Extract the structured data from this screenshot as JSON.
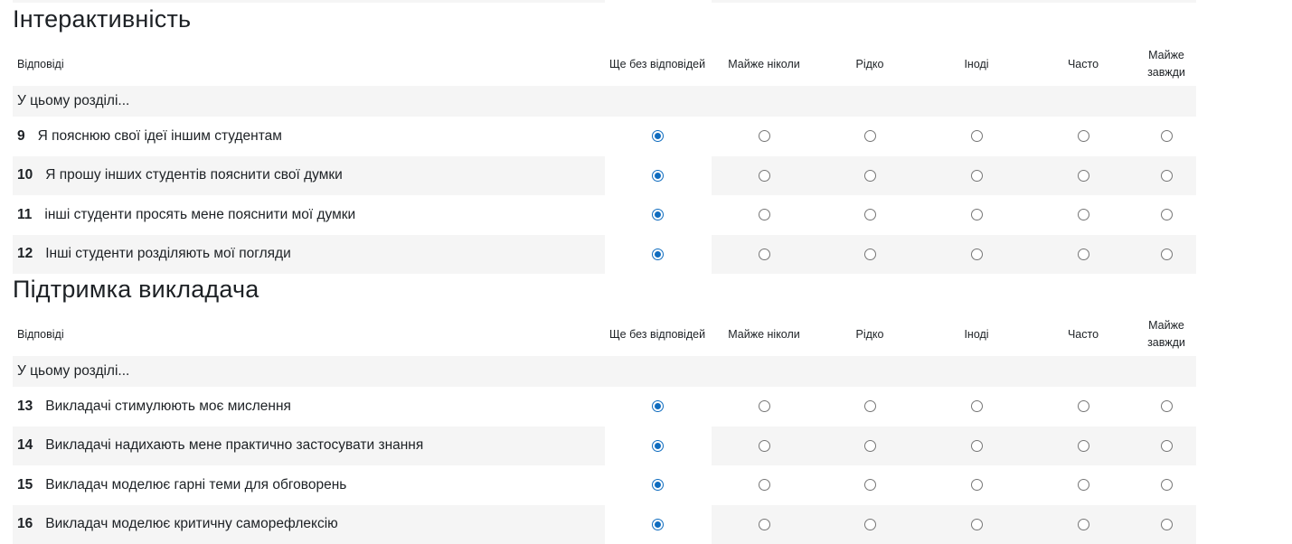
{
  "columns": [
    "Відповіді",
    "Ще без відповідей",
    "Майже ніколи",
    "Рідко",
    "Іноді",
    "Часто",
    "Майже\nзавжди"
  ],
  "colors": {
    "accent": "#0f6cbf",
    "row_shade": "#f5f5f5",
    "text": "#1d2125"
  },
  "sections": [
    {
      "title": "Інтерактивність",
      "intro": "У цьому розділі...",
      "questions": [
        {
          "num": "9",
          "text": "Я пояснюю свої ідеї іншим студентам",
          "selected": 0
        },
        {
          "num": "10",
          "text": "Я прошу інших студентів пояснити свої думки",
          "selected": 0
        },
        {
          "num": "11",
          "text": "інші студенти просять мене пояснити мої думки",
          "selected": 0
        },
        {
          "num": "12",
          "text": "Інші студенти розділяють мої погляди",
          "selected": 0
        }
      ]
    },
    {
      "title": "Підтримка викладача",
      "intro": "У цьому розділі...",
      "questions": [
        {
          "num": "13",
          "text": "Викладачі стимулюють моє мислення",
          "selected": 0
        },
        {
          "num": "14",
          "text": "Викладачі надихають мене практично застосувати знання",
          "selected": 0
        },
        {
          "num": "15",
          "text": "Викладач моделює гарні теми для обговорень",
          "selected": 0
        },
        {
          "num": "16",
          "text": "Викладач моделює критичну саморефлексію",
          "selected": 0
        }
      ]
    }
  ]
}
